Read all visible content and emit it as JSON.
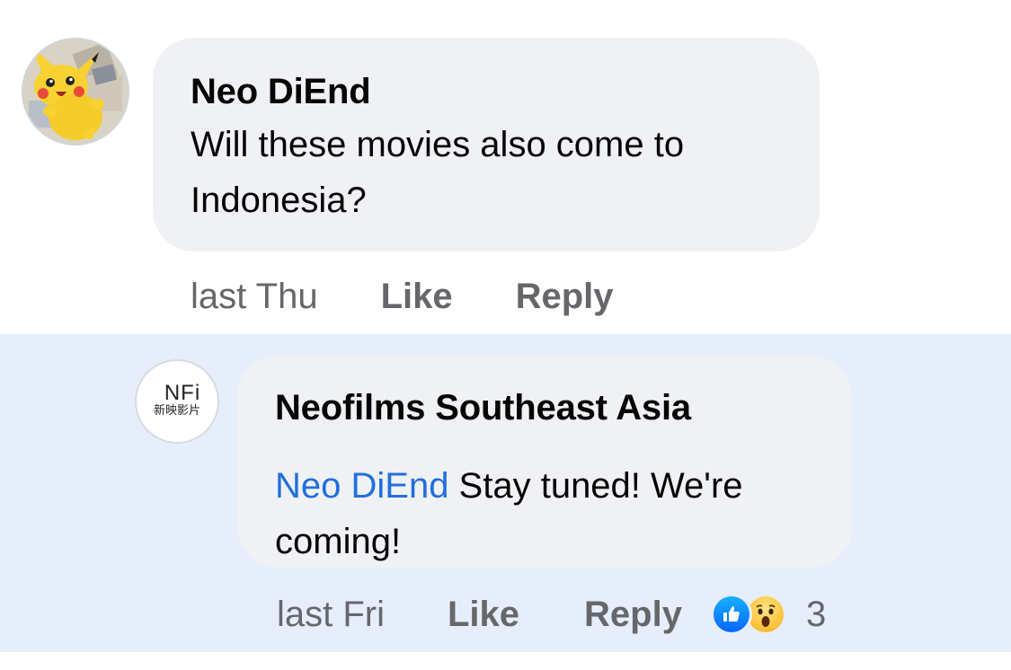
{
  "comment": {
    "author": "Neo DiEnd",
    "text": "Will these movies also come to Indonesia?",
    "time": "last Thu",
    "like_label": "Like",
    "reply_label": "Reply",
    "avatar_icon": "pikachu-avatar-icon"
  },
  "reply": {
    "author": "Neofilms Southeast Asia",
    "mention": "Neo DiEnd",
    "text_line1": " Stay tuned! We're",
    "text_line2": "coming!",
    "time": "last Fri",
    "like_label": "Like",
    "reply_label": "Reply",
    "reaction_count": "3",
    "avatar_logo_text": "NFi",
    "avatar_logo_subtext": "新映影片",
    "reactions": [
      "like-reaction-icon",
      "wow-reaction-icon"
    ]
  },
  "colors": {
    "bubble_bg": "#eff1f4",
    "reply_row_bg": "#e7eefb",
    "mention": "#216fdb",
    "meta_text": "#65676b"
  }
}
